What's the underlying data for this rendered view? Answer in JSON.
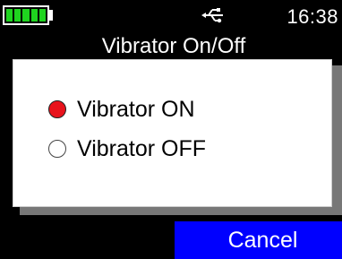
{
  "status_bar": {
    "time": "16:38",
    "battery_level": 1.0,
    "battery_icon": "battery-full-icon",
    "usb_icon": "usb-icon",
    "battery_color": "#1fd41f"
  },
  "header": {
    "title": "Vibrator On/Off"
  },
  "dialog": {
    "options": [
      {
        "label": "Vibrator ON",
        "selected": true
      },
      {
        "label": "Vibrator OFF",
        "selected": false
      }
    ],
    "selected_color": "#e8131c"
  },
  "softkeys": {
    "cancel_label": "Cancel",
    "cancel_color": "#0000ff"
  }
}
